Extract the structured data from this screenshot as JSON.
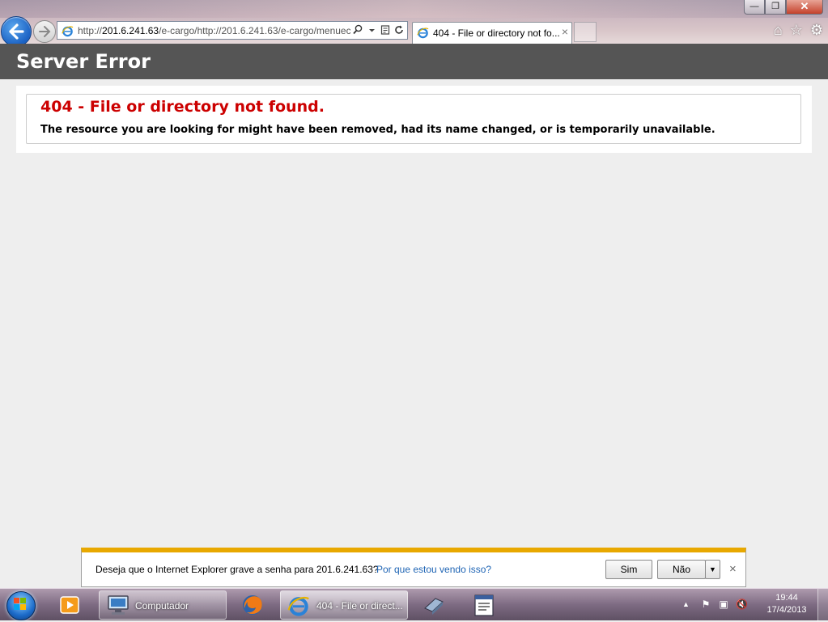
{
  "browser": {
    "url_prefix": "http://",
    "url_host": "201.6.241.63",
    "url_rest": "/e-cargo/http://201.6.241.63/e-cargo/menuec",
    "tab_title": "404 - File or directory not fo...",
    "tab_close": "×"
  },
  "page": {
    "header_title": "Server Error",
    "error_title": "404 - File or directory not found.",
    "error_message": "The resource you are looking for might have been removed, had its name changed, or is temporarily unavailable."
  },
  "notification": {
    "text": "Deseja que o Internet Explorer grave a senha para 201.6.241.63?",
    "link": "Por que estou vendo isso?",
    "yes_label": "Sim",
    "no_label": "Não",
    "dropdown_glyph": "▼",
    "close_glyph": "×"
  },
  "window_controls": {
    "minimize": "—",
    "restore": "❐",
    "close": "✕"
  },
  "taskbar": {
    "computer_label": "Computador",
    "ie_label": "404 - File or direct...",
    "time": "19:44",
    "date": "17/4/2013"
  },
  "colors": {
    "header_bg": "#555555",
    "error_title": "#cc0000",
    "page_bg": "#eeeeee",
    "notify_accent": "#e8a800",
    "link": "#1e64b4"
  }
}
